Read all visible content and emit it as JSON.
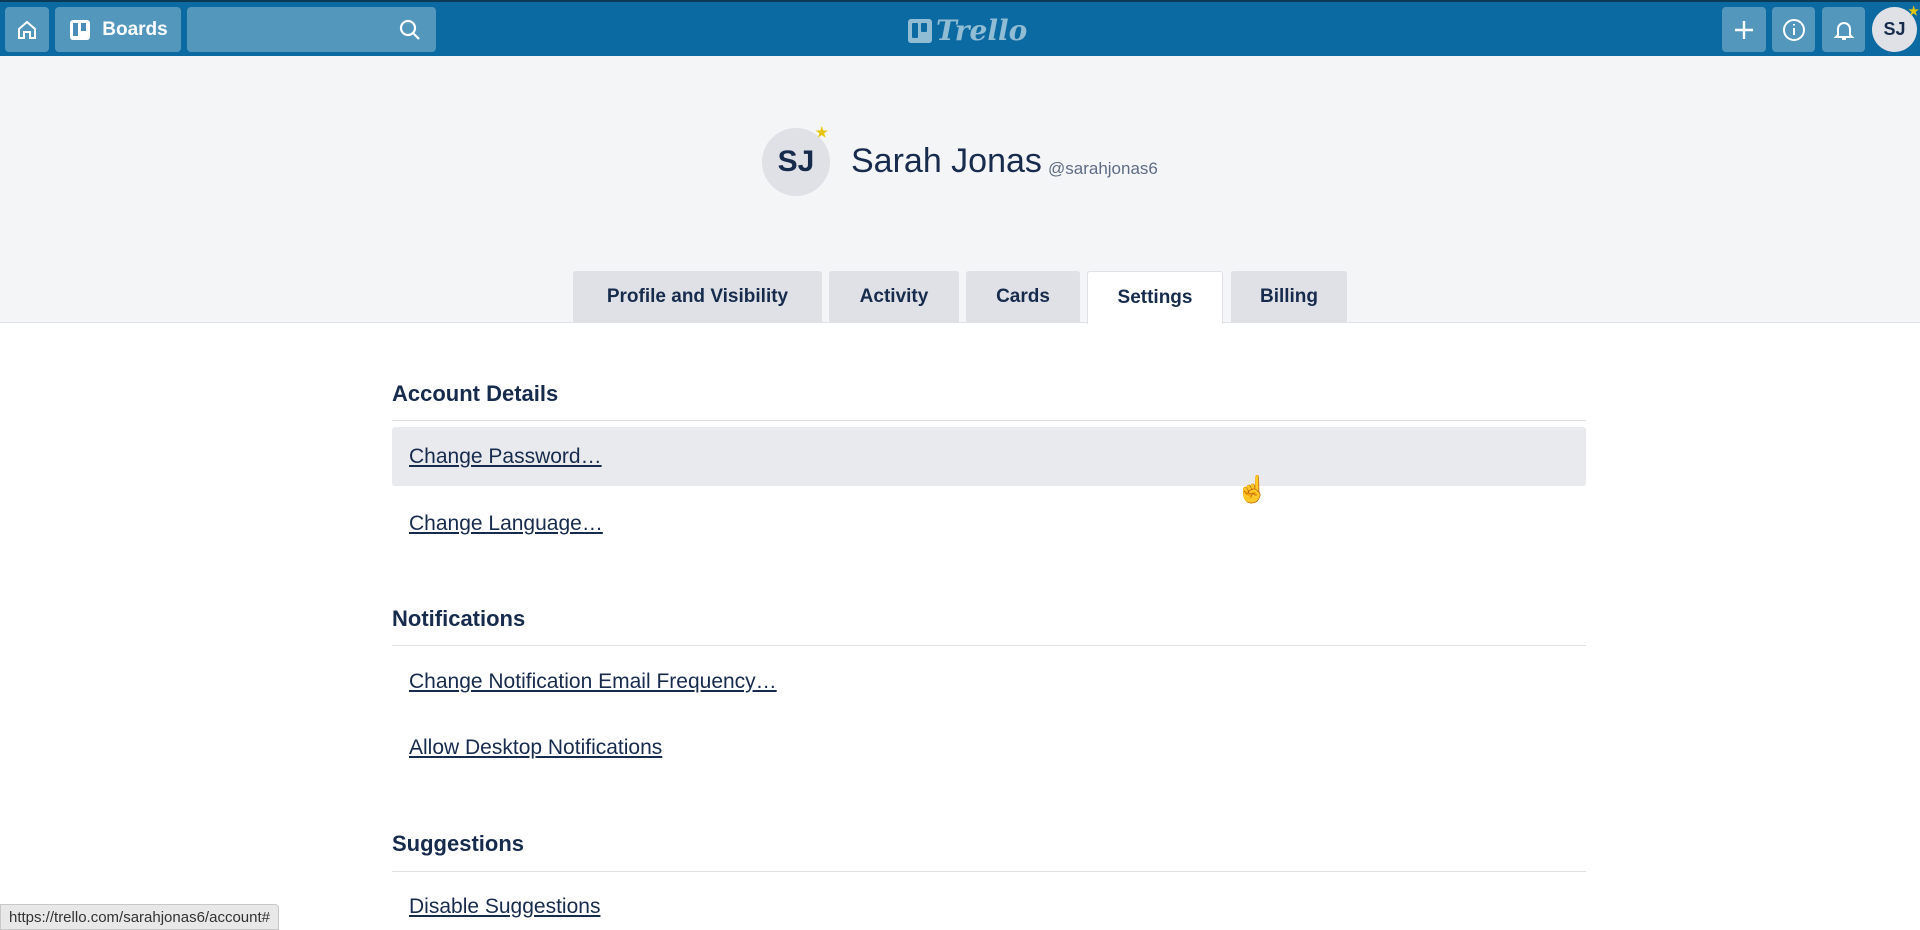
{
  "header": {
    "boards_label": "Boards",
    "logo_text": "Trello",
    "avatar_initials": "SJ",
    "colors": {
      "bar": "#0a6aa1"
    }
  },
  "profile": {
    "initials": "SJ",
    "name": "Sarah Jonas",
    "handle": "@sarahjonas6"
  },
  "tabs": [
    {
      "label": "Profile and Visibility"
    },
    {
      "label": "Activity"
    },
    {
      "label": "Cards"
    },
    {
      "label": "Settings",
      "active": true
    },
    {
      "label": "Billing"
    }
  ],
  "sections": [
    {
      "title": "Account Details",
      "links": [
        "Change Password…",
        "Change Language…"
      ]
    },
    {
      "title": "Notifications",
      "links": [
        "Change Notification Email Frequency…",
        "Allow Desktop Notifications"
      ]
    },
    {
      "title": "Suggestions",
      "links": [
        "Disable Suggestions"
      ]
    }
  ],
  "status_url": "https://trello.com/sarahjonas6/account#"
}
